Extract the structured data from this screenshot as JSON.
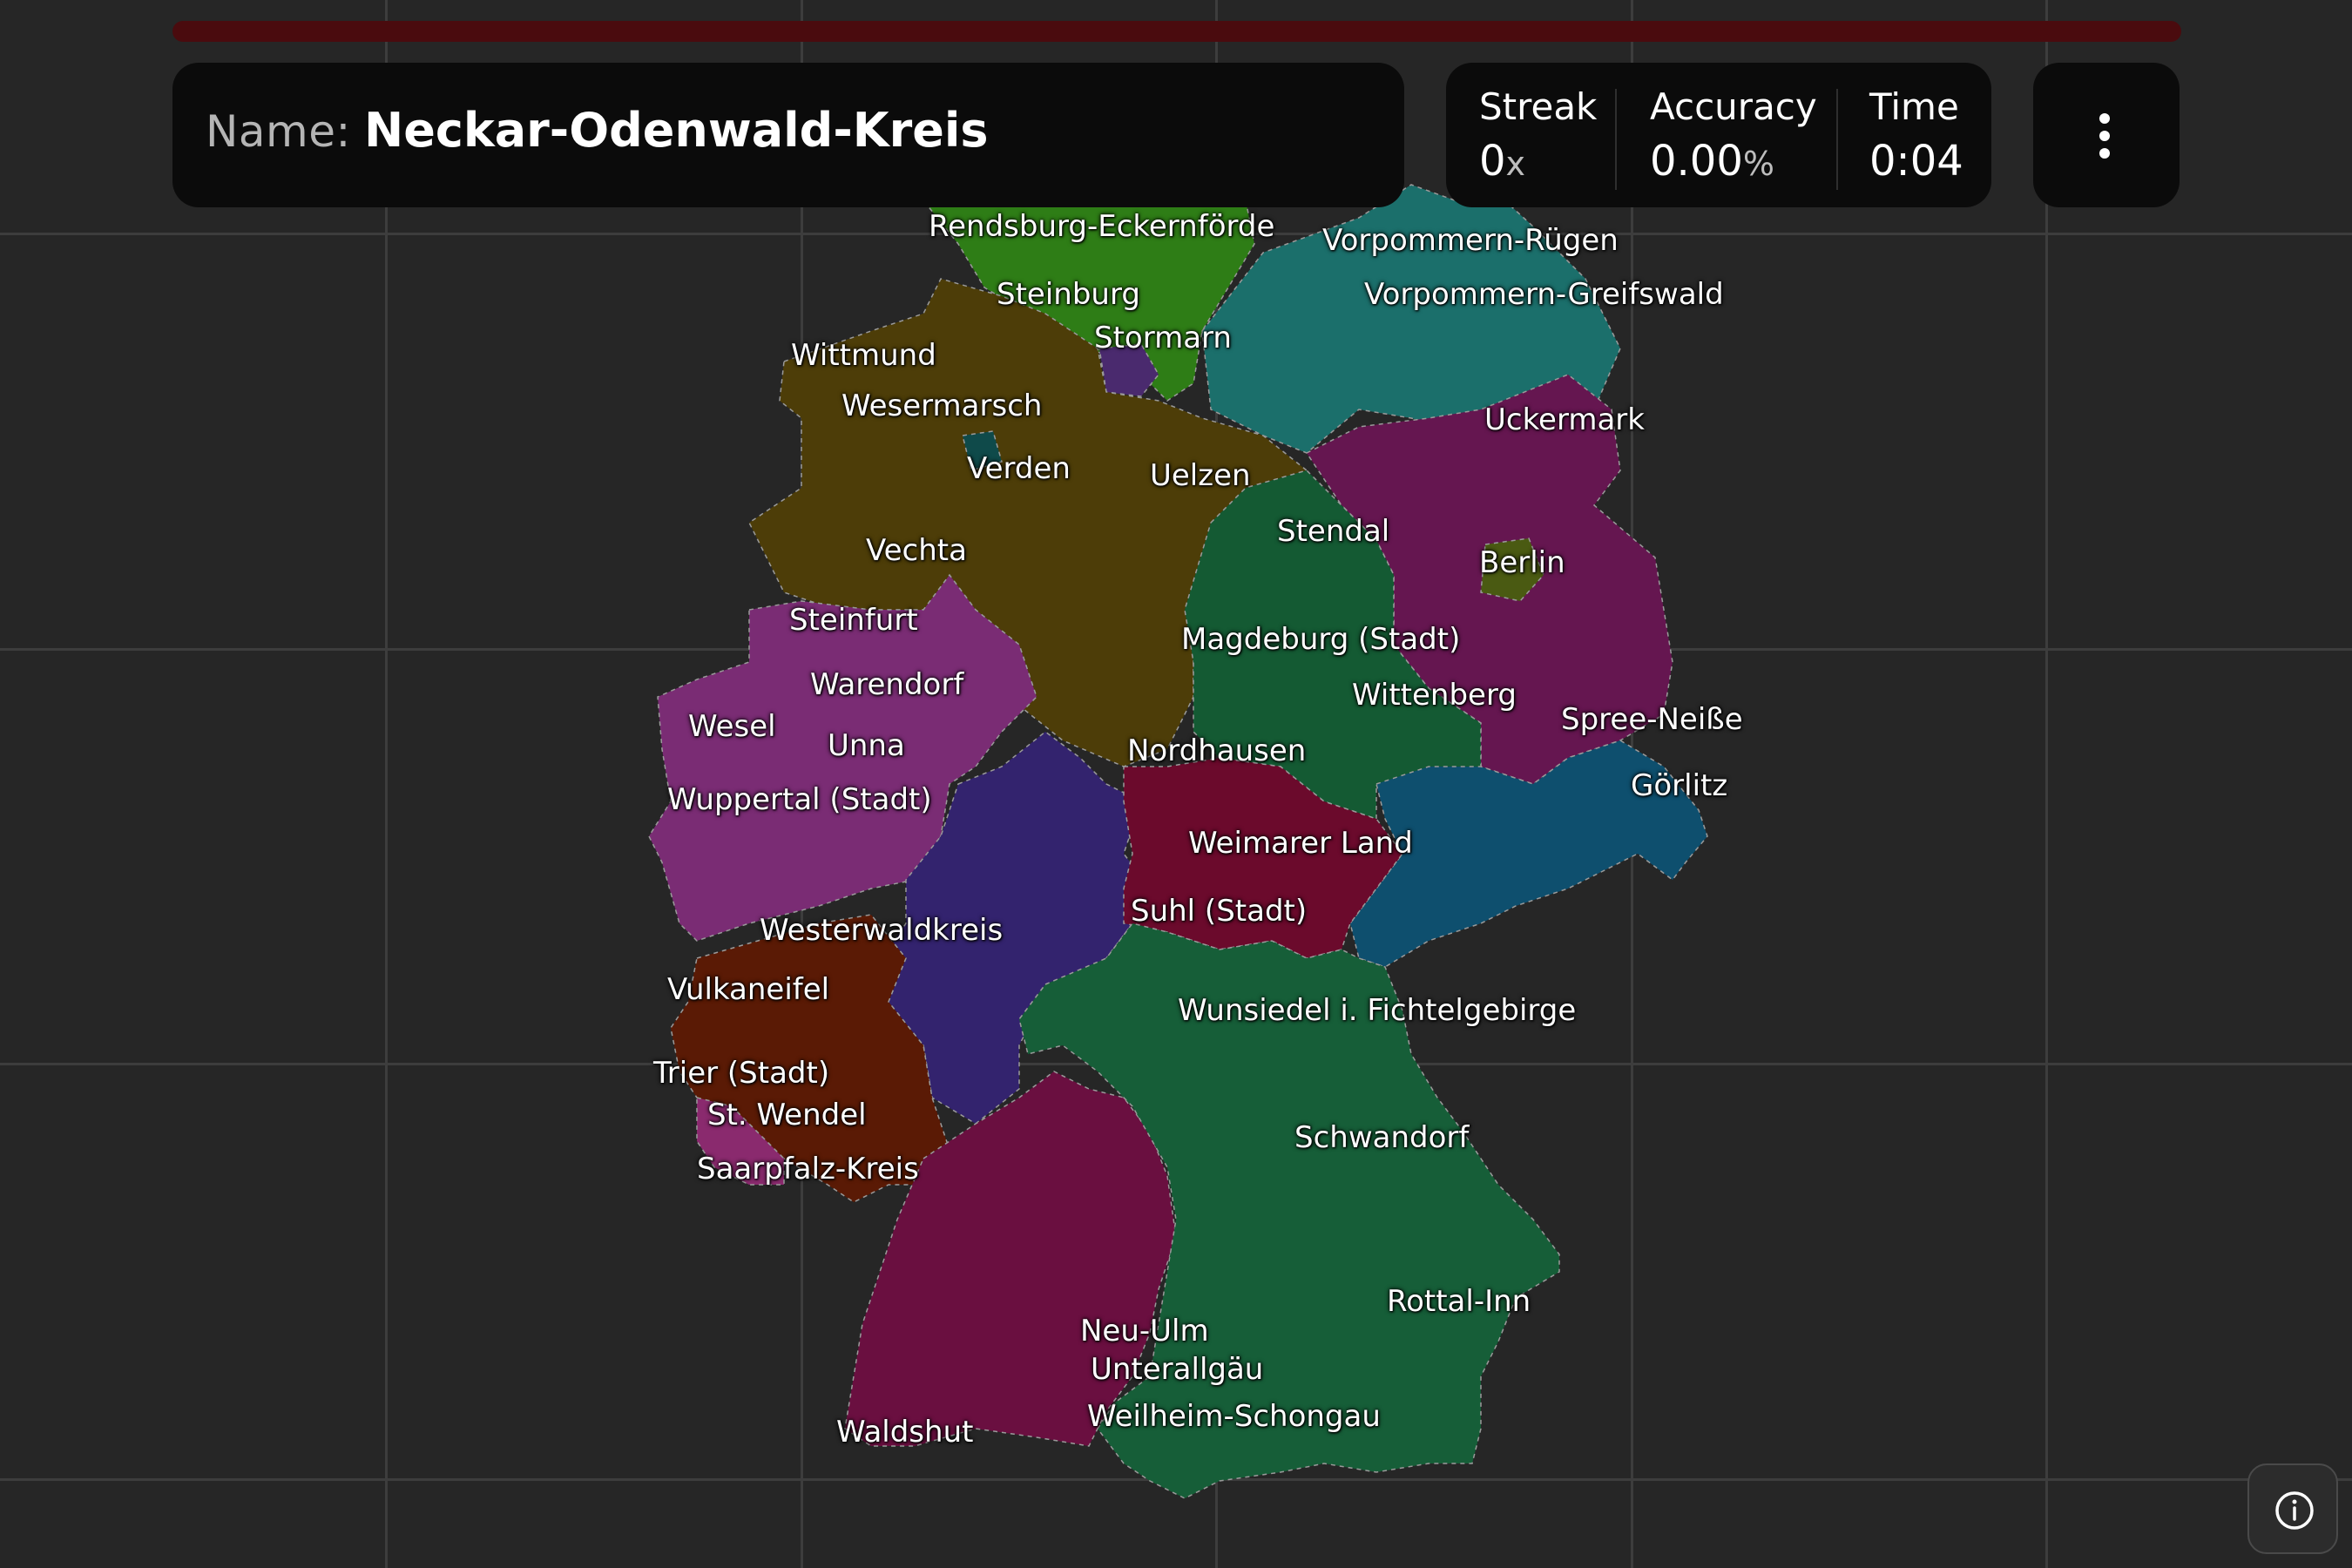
{
  "header": {
    "name_label": "Name:",
    "name_value": "Neckar-Odenwald-Kreis",
    "progress_fraction": 0.0
  },
  "stats": {
    "streak": {
      "label": "Streak",
      "value": "0",
      "unit": "x"
    },
    "accuracy": {
      "label": "Accuracy",
      "value": "0.00",
      "unit": "%"
    },
    "time": {
      "label": "Time",
      "value": "0:04"
    }
  },
  "menu": {
    "icon": "more-vertical-icon"
  },
  "info": {
    "icon": "info-icon"
  },
  "map": {
    "labels": [
      "Rendsburg-Eckernförde",
      "Vorpommern-Rügen",
      "Steinburg",
      "Vorpommern-Greifswald",
      "Stormarn",
      "Wittmund",
      "Wesermarsch",
      "Uckermark",
      "Verden",
      "Uelzen",
      "Stendal",
      "Vechta",
      "Berlin",
      "Steinfurt",
      "Magdeburg (Stadt)",
      "Warendorf",
      "Wittenberg",
      "Wesel",
      "Spree-Neiße",
      "Unna",
      "Nordhausen",
      "Görlitz",
      "Wuppertal (Stadt)",
      "Weimarer Land",
      "Suhl (Stadt)",
      "Westerwaldkreis",
      "Vulkaneifel",
      "Wunsiedel i. Fichtelgebirge",
      "Trier (Stadt)",
      "St. Wendel",
      "Schwandorf",
      "Saarpfalz-Kreis",
      "Rottal-Inn",
      "Neu-Ulm",
      "Unterallgäu",
      "Weilheim-Schongau",
      "Waldshut"
    ],
    "region_colors": {
      "schleswig_holstein": "#2e7d16",
      "hamburg": "#4a2a6e",
      "mecklenburg_vorpommern": "#1b6f6b",
      "niedersachsen": "#4d3d08",
      "bremen": "#0f4a4a",
      "brandenburg": "#651650",
      "berlin": "#4a5a12",
      "sachsen_anhalt": "#145a33",
      "nordrhein_westfalen": "#7a2c74",
      "hessen": "#33236e",
      "thueringen": "#6b0a2c",
      "sachsen": "#0e4f6e",
      "rheinland_pfalz": "#5a1a05",
      "saarland": "#8a2a6e",
      "baden_wuerttemberg": "#6a0f40",
      "bayern": "#165e38"
    }
  }
}
